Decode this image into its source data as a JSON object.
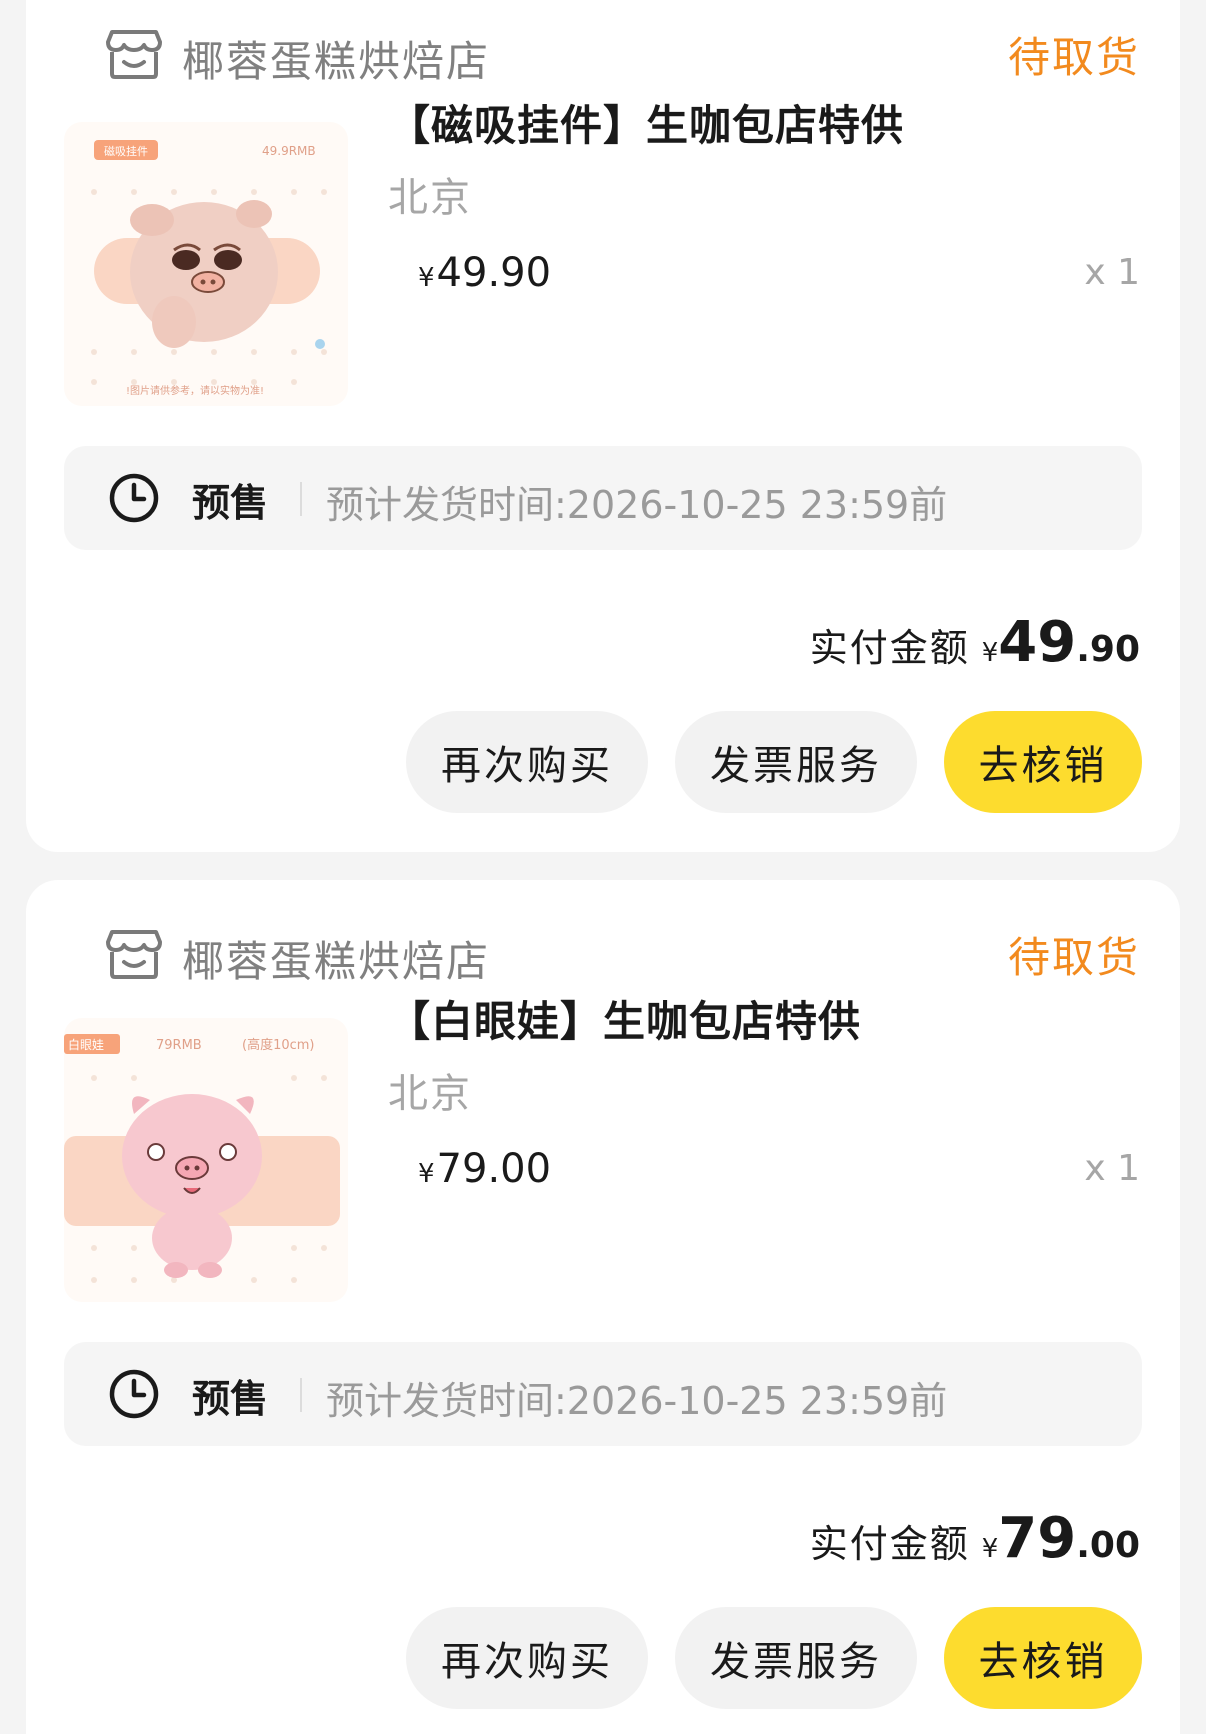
{
  "orders": [
    {
      "shop_name": "椰蓉蛋糕烘焙店",
      "status": "待取货",
      "product": {
        "title": "【磁吸挂件】生咖包店特供",
        "city": "北京",
        "price_symbol": "¥",
        "price": "49.90",
        "quantity": "x 1",
        "image_tag": "磁吸挂件",
        "image_price": "49.9RMB",
        "image_note": "!图片请供参考，请以实物为准!"
      },
      "presale": {
        "label": "预售",
        "eta": "预计发货时间:2026-10-25 23:59前"
      },
      "paid": {
        "label": "实付金额",
        "symbol": "¥",
        "integer": "49",
        "decimal": ".90"
      },
      "buttons": {
        "rebuy": "再次购买",
        "invoice": "发票服务",
        "verify": "去核销"
      }
    },
    {
      "shop_name": "椰蓉蛋糕烘焙店",
      "status": "待取货",
      "product": {
        "title": "【白眼娃】生咖包店特供",
        "city": "北京",
        "price_symbol": "¥",
        "price": "79.00",
        "quantity": "x 1",
        "image_tag": "白眼娃",
        "image_price": "79RMB",
        "image_size": "(高度10cm)"
      },
      "presale": {
        "label": "预售",
        "eta": "预计发货时间:2026-10-25 23:59前"
      },
      "paid": {
        "label": "实付金额",
        "symbol": "¥",
        "integer": "79",
        "decimal": ".00"
      },
      "buttons": {
        "rebuy": "再次购买",
        "invoice": "发票服务",
        "verify": "去核销"
      }
    }
  ],
  "colors": {
    "status": "#f28a1e",
    "primary_button": "#fddc2e",
    "secondary_button": "#f2f2f2"
  },
  "icons": {
    "shop": "shop-icon",
    "clock": "clock-icon"
  }
}
